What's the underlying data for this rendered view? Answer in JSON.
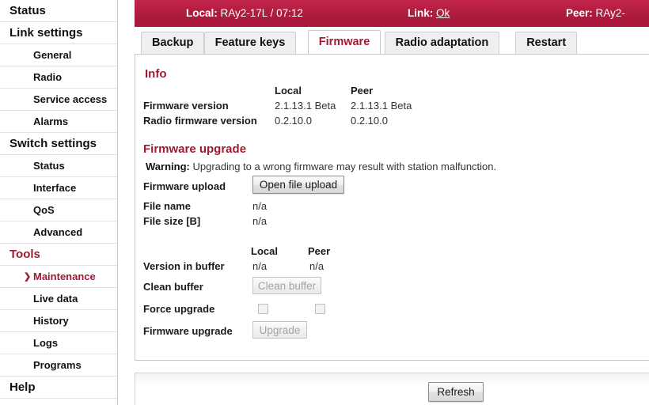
{
  "sidebar": {
    "entries": [
      {
        "label": "Status",
        "type": "group",
        "active": false
      },
      {
        "label": "Link settings",
        "type": "group",
        "active": false
      },
      {
        "label": "General",
        "type": "item",
        "active": false
      },
      {
        "label": "Radio",
        "type": "item",
        "active": false
      },
      {
        "label": "Service access",
        "type": "item",
        "active": false
      },
      {
        "label": "Alarms",
        "type": "item",
        "active": false
      },
      {
        "label": "Switch settings",
        "type": "group",
        "active": false
      },
      {
        "label": "Status",
        "type": "item",
        "active": false
      },
      {
        "label": "Interface",
        "type": "item",
        "active": false
      },
      {
        "label": "QoS",
        "type": "item",
        "active": false
      },
      {
        "label": "Advanced",
        "type": "item",
        "active": false
      },
      {
        "label": "Tools",
        "type": "group",
        "accent": true,
        "active": false
      },
      {
        "label": "Maintenance",
        "type": "item",
        "active": true
      },
      {
        "label": "Live data",
        "type": "item",
        "active": false
      },
      {
        "label": "History",
        "type": "item",
        "active": false
      },
      {
        "label": "Logs",
        "type": "item",
        "active": false
      },
      {
        "label": "Programs",
        "type": "item",
        "active": false
      },
      {
        "label": "Help",
        "type": "group",
        "active": false
      }
    ],
    "active_marker_icon": "chevron-right-icon",
    "active_marker_glyph": "❯"
  },
  "topbar": {
    "local_key": "Local:",
    "local_value": "RAy2-17L / 07:12",
    "link_key": "Link:",
    "link_value": "Ok",
    "peer_key": "Peer:",
    "peer_value": "RAy2-",
    "accent_color": "#b21e40"
  },
  "tabs": [
    {
      "label": "Backup",
      "active": false
    },
    {
      "label": "Feature keys",
      "active": false
    },
    {
      "label": "Firmware",
      "active": true
    },
    {
      "label": "Radio adaptation",
      "active": false
    },
    {
      "label": "Restart",
      "active": false
    }
  ],
  "info": {
    "title": "Info",
    "col_local": "Local",
    "col_peer": "Peer",
    "rows": [
      {
        "label": "Firmware version",
        "local": "2.1.13.1 Beta",
        "peer": "2.1.13.1 Beta"
      },
      {
        "label": "Radio firmware version",
        "local": "0.2.10.0",
        "peer": "0.2.10.0"
      }
    ]
  },
  "upgrade": {
    "title": "Firmware upgrade",
    "warning_label": "Warning:",
    "warning_text": "Upgrading to a wrong firmware may result with station malfunction.",
    "firmware_upload_label": "Firmware upload",
    "open_file_upload_button": "Open file upload",
    "file_name_label": "File name",
    "file_name_value": "n/a",
    "file_size_label": "File size [B]",
    "file_size_value": "n/a",
    "col_local": "Local",
    "col_peer": "Peer",
    "version_in_buffer_label": "Version in buffer",
    "version_in_buffer_local": "n/a",
    "version_in_buffer_peer": "n/a",
    "clean_buffer_label": "Clean buffer",
    "clean_buffer_button": "Clean buffer",
    "force_upgrade_label": "Force upgrade",
    "force_upgrade_local_checked": false,
    "force_upgrade_peer_checked": false,
    "firmware_upgrade_label": "Firmware upgrade",
    "upgrade_button": "Upgrade"
  },
  "footer": {
    "refresh_button": "Refresh"
  }
}
